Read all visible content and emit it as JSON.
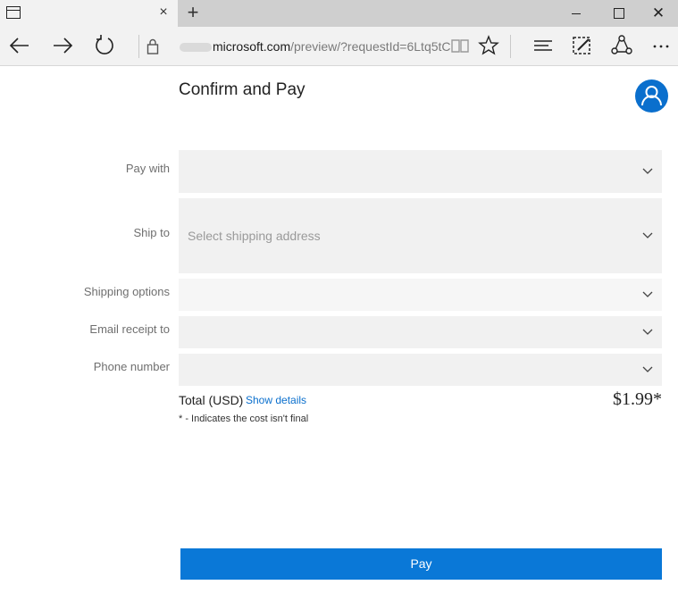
{
  "browser": {
    "tab_close_glyph": "×",
    "new_tab_glyph": "+",
    "window_close_glyph": "✕",
    "url_host": "microsoft.com",
    "url_path": "/preview/?requestId=6Ltq5tC",
    "icons": [
      "tab-page-icon",
      "back-arrow-icon",
      "forward-arrow-icon",
      "refresh-icon",
      "lock-icon",
      "reading-view-icon",
      "favorite-star-icon",
      "hub-icon",
      "web-note-icon",
      "share-icon",
      "more-icon"
    ]
  },
  "page": {
    "title": "Confirm and Pay",
    "avatar_icon": "user-icon"
  },
  "form": {
    "pay_with_label": "Pay with",
    "pay_with_value": "",
    "ship_to_label": "Ship to",
    "ship_to_placeholder": "Select shipping address",
    "shipping_options_label": "Shipping options",
    "shipping_options_value": "",
    "email_label": "Email receipt to",
    "email_value": "",
    "phone_label": "Phone number",
    "phone_value": ""
  },
  "summary": {
    "total_label": "Total (USD)",
    "show_details": "Show details",
    "price": "$1.99*",
    "note": "* - Indicates the cost isn't final"
  },
  "actions": {
    "pay_label": "Pay"
  },
  "colors": {
    "accent": "#0a78d7",
    "avatar": "#0a6fcd",
    "link": "#0a6fcd",
    "field_bg": "#f1f1f1"
  }
}
